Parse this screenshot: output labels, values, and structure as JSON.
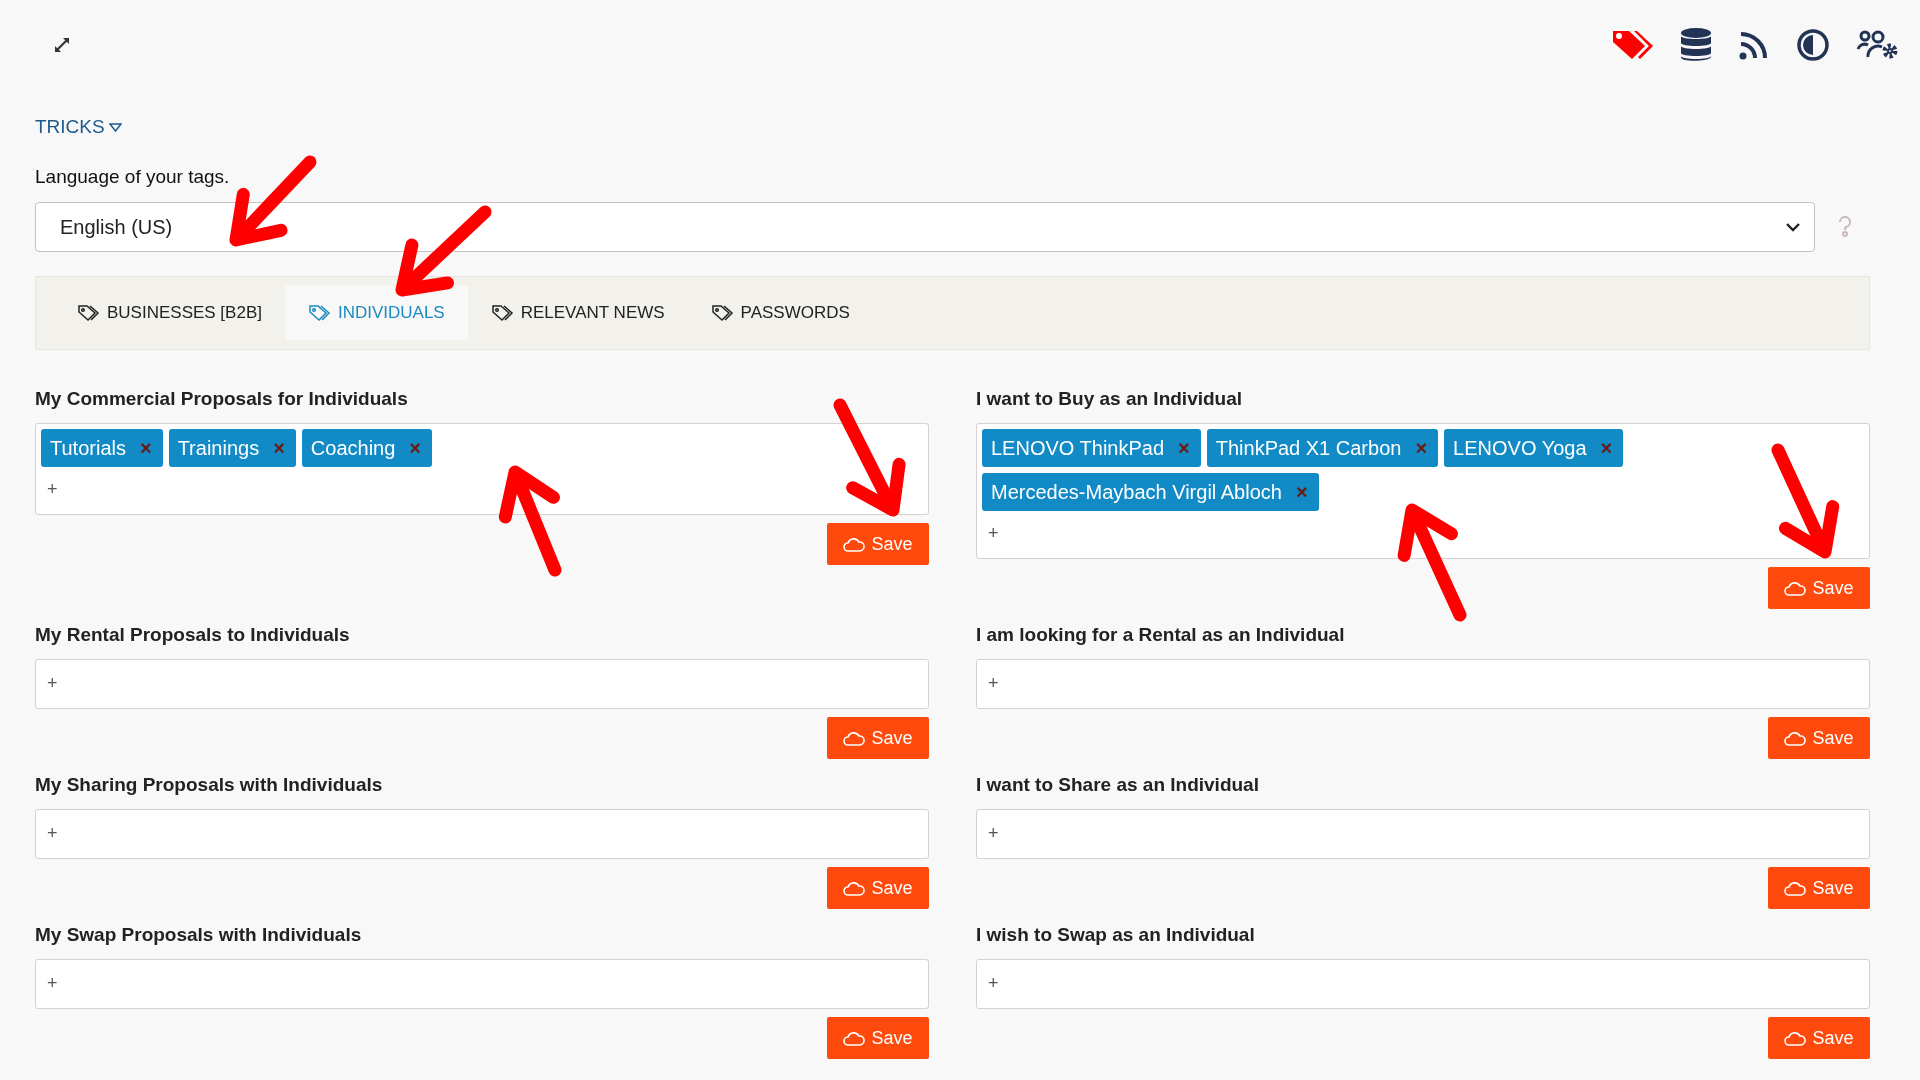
{
  "tricks": {
    "label": "TRICKS"
  },
  "language": {
    "label": "Language of your tags.",
    "value": "English (US)"
  },
  "tabs": [
    {
      "label": "BUSINESSES [B2B]",
      "selected": false
    },
    {
      "label": "INDIVIDUALS",
      "selected": true
    },
    {
      "label": "RELEVANT NEWS",
      "selected": false
    },
    {
      "label": "PASSWORDS",
      "selected": false
    }
  ],
  "sections": [
    {
      "title": "My Commercial Proposals for Individuals",
      "tags": [
        {
          "label": "Tutorials",
          "remove": "×"
        },
        {
          "label": "Trainings",
          "remove": "×"
        },
        {
          "label": "Coaching",
          "remove": "×"
        }
      ],
      "add": "+",
      "save": "Save"
    },
    {
      "title": "I want to Buy as an Individual",
      "tags": [
        {
          "label": "LENOVO ThinkPad",
          "remove": "×"
        },
        {
          "label": "ThinkPad X1 Carbon",
          "remove": "×"
        },
        {
          "label": "LENOVO Yoga",
          "remove": "×"
        },
        {
          "label": "Mercedes-Maybach Virgil Abloch",
          "remove": "×"
        }
      ],
      "add": "+",
      "save": "Save"
    },
    {
      "title": "My Rental Proposals to Individuals",
      "add": "+",
      "save": "Save"
    },
    {
      "title": "I am looking for a Rental as an Individual",
      "add": "+",
      "save": "Save"
    },
    {
      "title": "My Sharing Proposals with Individuals",
      "add": "+",
      "save": "Save"
    },
    {
      "title": "I want to Share as an Individual",
      "add": "+",
      "save": "Save"
    },
    {
      "title": "My Swap Proposals with Individuals",
      "add": "+",
      "save": "Save"
    },
    {
      "title": "I wish to Swap as an Individual",
      "add": "+",
      "save": "Save"
    }
  ]
}
